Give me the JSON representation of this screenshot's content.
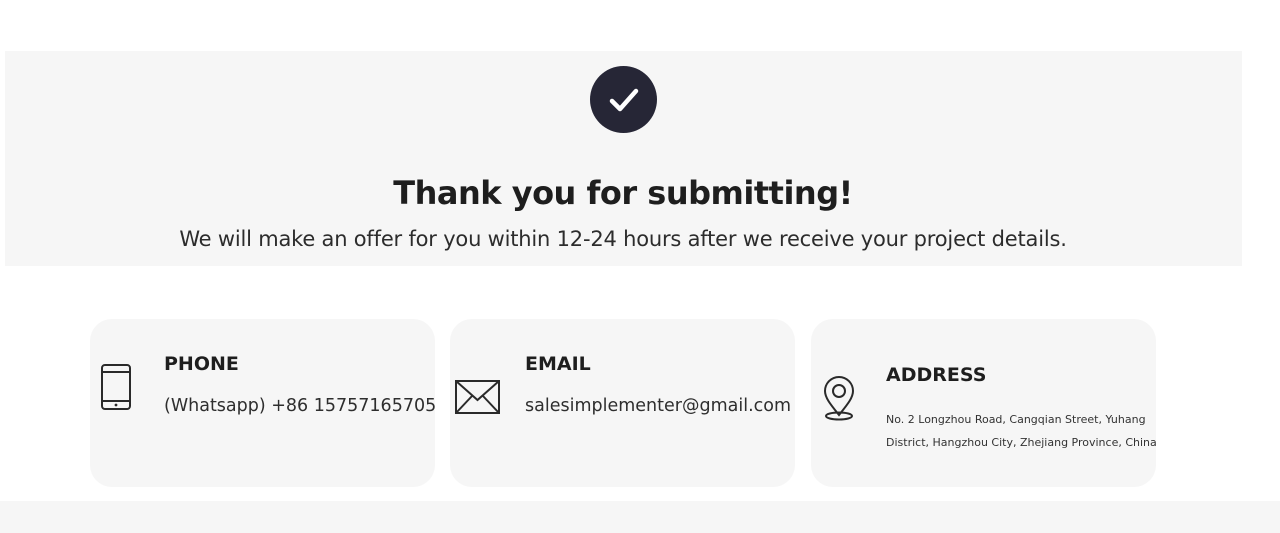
{
  "confirmation": {
    "title": "Thank you for submitting!",
    "message": "We will make an offer for you within 12-24 hours after we receive your project details."
  },
  "contacts": {
    "phone": {
      "heading": "PHONE",
      "value": "(Whatsapp) +86 15757165705",
      "icon": "smartphone-icon"
    },
    "email": {
      "heading": "EMAIL",
      "value": "salesimplementer@gmail.com",
      "icon": "envelope-icon"
    },
    "address": {
      "heading": "ADDRESS",
      "line1": "No. 2 Longzhou Road, Cangqian Street, Yuhang",
      "line2": "District, Hangzhou City, Zhejiang Province, China",
      "icon": "location-pin-icon"
    }
  },
  "colors": {
    "check_circle": "#262636",
    "panel_bg": "#f6f6f6",
    "text_dark": "#1e1e1e"
  }
}
